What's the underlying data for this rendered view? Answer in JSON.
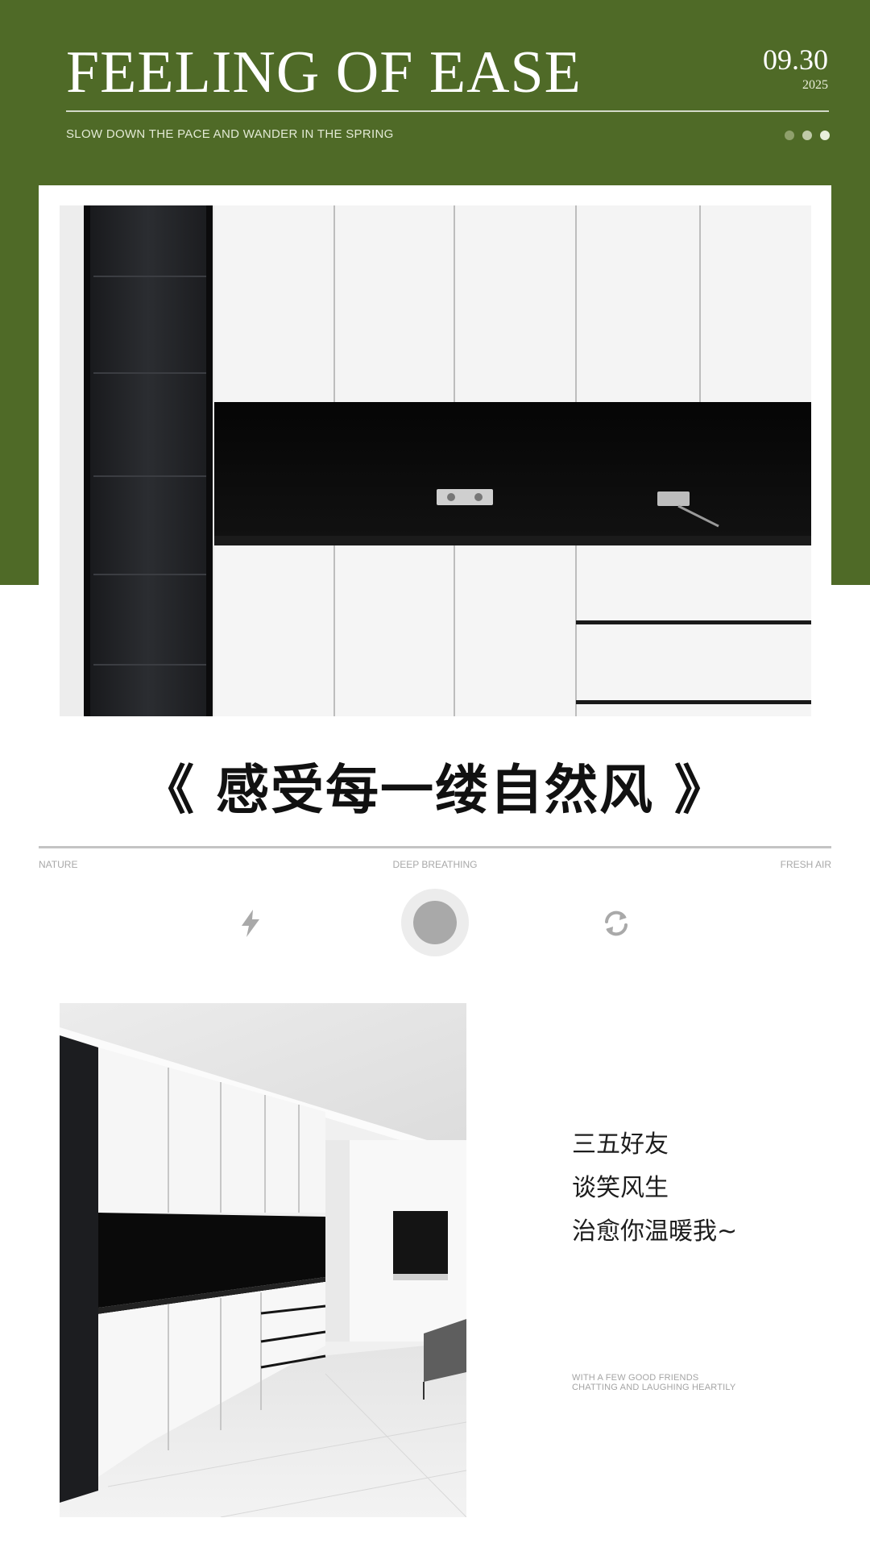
{
  "header": {
    "title": "FEELING OF EASE",
    "date": "09.30",
    "year": "2025",
    "subtitle": "SLOW DOWN THE PACE AND WANDER IN THE SPRING",
    "pagination_dots": 3
  },
  "heading": "《 感受每一缕自然风 》",
  "labels": {
    "left": "NATURE",
    "center": "DEEP BREATHING",
    "right": "FRESH AIR"
  },
  "icons": [
    "bolt-icon",
    "circle-button-icon",
    "refresh-icon"
  ],
  "poem": {
    "lines": [
      "三五好友",
      "谈笑风生",
      "治愈你温暖我~"
    ],
    "english_lines": [
      "WITH A FEW GOOD FRIENDS",
      "CHATTING AND LAUGHING HEARTILY"
    ]
  },
  "colors": {
    "brand_green": "#4f6a27",
    "icon_gray": "#a9a9a9"
  }
}
